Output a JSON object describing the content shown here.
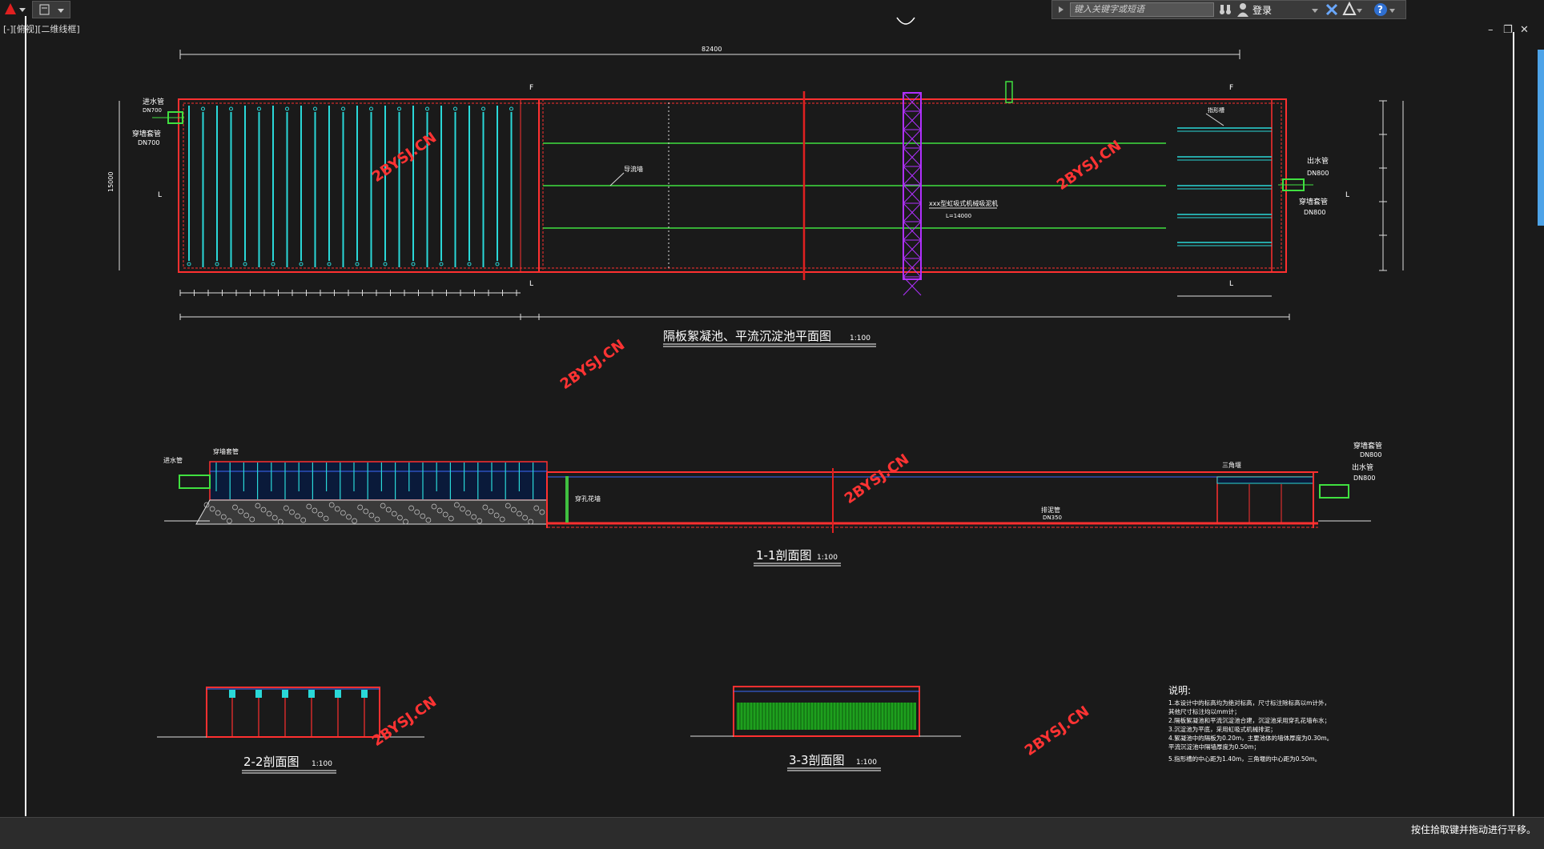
{
  "toolbar": {
    "search_placeholder": "键入关键字或短语",
    "login_label": "登录"
  },
  "viewport": {
    "label": "[-][俯视][二维线框]"
  },
  "drawing": {
    "plan_title": "隔板絮凝池、平流沉淀池平面图",
    "plan_scale": "1:100",
    "sec11_title": "1-1剖面图",
    "sec11_scale": "1:100",
    "sec22_title": "2-2剖面图",
    "sec22_scale": "1:100",
    "sec33_title": "3-3剖面图",
    "sec33_scale": "1:100",
    "watermark": "2BYSJ.CN",
    "labels": {
      "inlet_pipe": "进水管",
      "dn700": "DN700",
      "wall_sleeve": "穿墙套管",
      "outlet_pipe": "出水管",
      "dn800": "DN800",
      "guide_wall": "导流墙",
      "suction_dredger": "xxx型虹吸式机械吸泥机",
      "dredger_length": "L=14000",
      "overflow_weir": "指形槽",
      "sludge_pipe": "排泥管",
      "sludge_dn": "DN350",
      "triangle_weir": "三角堰",
      "perforated_wall": "穿孔花墙",
      "dim_total": "82400",
      "dim_width": "15000"
    },
    "notes": {
      "title": "说明:",
      "lines": [
        "1.本设计中的标高均为绝对标高，尺寸标注除标高以m计外，",
        "其他尺寸标注均以mm计；",
        "2.隔板絮凝池和平流沉淀池合建，沉淀池采用穿孔花墙布水；",
        "3.沉淀池为平底，采用虹吸式机械排泥；",
        "4.絮凝池中的隔板为0.20m，主要池体的墙体厚度为0.30m。",
        "平流沉淀池中隔墙厚度为0.50m；",
        "5.指形槽的中心距为1.40m，三角堰的中心距为0.50m。"
      ]
    },
    "colors": {
      "wall": "#ff3030",
      "baffle": "#2ad8d8",
      "water": "#3b6bff",
      "weir": "#40c040",
      "dredger": "#b030ff",
      "watermark": "#ff3333",
      "text": "#ffffff"
    }
  },
  "status": {
    "message": "按住拾取键并拖动进行平移。"
  }
}
